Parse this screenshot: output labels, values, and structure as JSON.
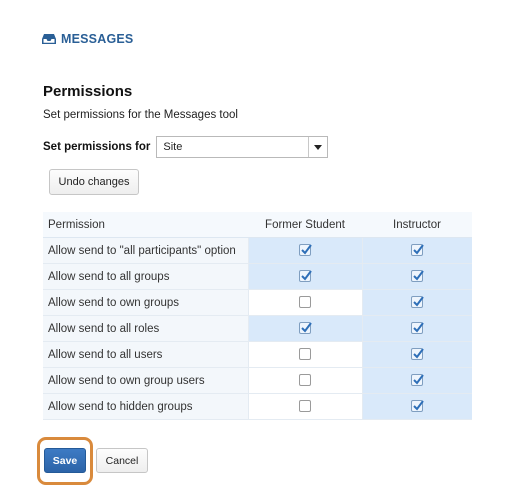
{
  "header": {
    "title": "MESSAGES",
    "icon": "inbox-icon",
    "color": "#2a5f96"
  },
  "page": {
    "title": "Permissions",
    "subtitle": "Set permissions for the Messages tool"
  },
  "permissions_for": {
    "label": "Set permissions for",
    "selected": "Site"
  },
  "undo_label": "Undo changes",
  "table": {
    "headers": [
      "Permission",
      "Former Student",
      "Instructor"
    ],
    "rows": [
      {
        "label": "Allow send to \"all participants\" option",
        "former_student": true,
        "instructor": true
      },
      {
        "label": "Allow send to all groups",
        "former_student": true,
        "instructor": true
      },
      {
        "label": "Allow send to own groups",
        "former_student": false,
        "instructor": true
      },
      {
        "label": "Allow send to all roles",
        "former_student": true,
        "instructor": true
      },
      {
        "label": "Allow send to all users",
        "former_student": false,
        "instructor": true
      },
      {
        "label": "Allow send to own group users",
        "former_student": false,
        "instructor": true
      },
      {
        "label": "Allow send to hidden groups",
        "former_student": false,
        "instructor": true
      }
    ]
  },
  "actions": {
    "save_label": "Save",
    "cancel_label": "Cancel"
  },
  "colors": {
    "accent": "#2c64a8",
    "highlight": "#d98a3c",
    "checked_cell": "#d9e9fa"
  }
}
